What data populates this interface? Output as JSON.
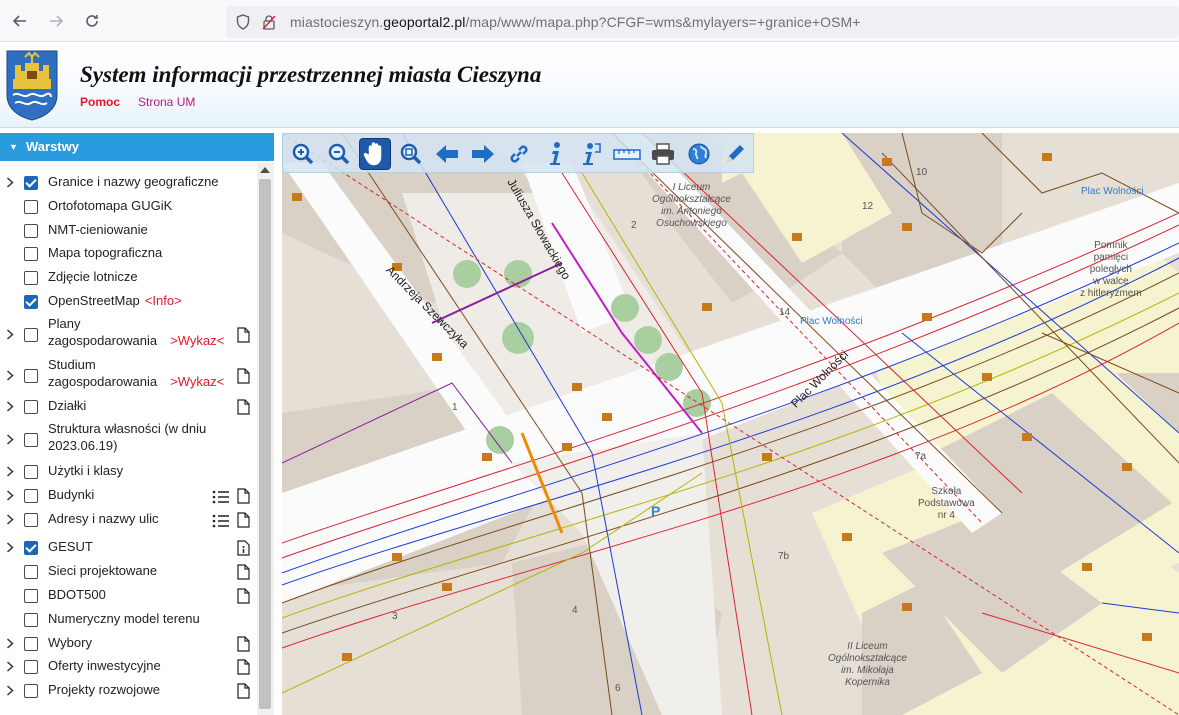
{
  "browser": {
    "url_prefix": "miastocieszyn.",
    "url_domain": "geoportal2.pl",
    "url_path": "/map/www/mapa.php?CFGF=wms&mylayers=+granice+OSM+"
  },
  "header": {
    "title": "System informacji przestrzennej miasta Cieszyna",
    "help_link": "Pomoc",
    "um_link": "Strona UM"
  },
  "sidebar": {
    "title": "Warstwy",
    "layers": [
      {
        "label": "Granice i nazwy geograficzne",
        "checked": true,
        "expandable": true
      },
      {
        "label": "Ortofotomapa GUGiK",
        "checked": false,
        "expandable": false
      },
      {
        "label": "NMT-cieniowanie",
        "checked": false,
        "expandable": false
      },
      {
        "label": "Mapa topograficzna",
        "checked": false,
        "expandable": false
      },
      {
        "label": "Zdjęcie lotnicze",
        "checked": false,
        "expandable": false
      },
      {
        "label": "OpenStreetMap",
        "link": "<Info>",
        "checked": true,
        "expandable": false
      },
      {
        "label_line1": "Plany",
        "label_line2": "zagospodarowania",
        "link": ">Wykaz<",
        "checked": false,
        "expandable": true,
        "doc": true
      },
      {
        "label_line1": "Studium",
        "label_line2": "zagospodarowania",
        "link": ">Wykaz<",
        "checked": false,
        "expandable": true,
        "doc": true
      },
      {
        "label": "Działki",
        "checked": false,
        "expandable": true,
        "doc": true
      },
      {
        "label_line1": "Struktura własności (w dniu",
        "label_line2": "2023.06.19)",
        "checked": false,
        "expandable": true
      },
      {
        "label": "Użytki i klasy",
        "checked": false,
        "expandable": true
      },
      {
        "label": "Budynki",
        "checked": false,
        "expandable": true,
        "doc": true,
        "list": true
      },
      {
        "label": "Adresy i nazwy ulic",
        "checked": false,
        "expandable": true,
        "doc": true,
        "list": true
      },
      {
        "label": "GESUT",
        "checked": true,
        "expandable": true,
        "info_doc": true
      },
      {
        "label": "Sieci projektowane",
        "checked": false,
        "expandable": false,
        "doc": true
      },
      {
        "label": "BDOT500",
        "checked": false,
        "expandable": false,
        "doc": true
      },
      {
        "label": "Numeryczny model terenu",
        "checked": false,
        "expandable": false
      },
      {
        "label": "Wybory",
        "checked": false,
        "expandable": true,
        "doc": true
      },
      {
        "label": "Oferty inwestycyjne",
        "checked": false,
        "expandable": true,
        "doc": true
      },
      {
        "label": "Projekty rozwojowe",
        "checked": false,
        "expandable": true,
        "doc": true
      }
    ]
  },
  "toolbar": {
    "tools": [
      "zoom-in-icon",
      "zoom-out-icon",
      "pan-hand-icon",
      "zoom-box-icon",
      "back-arrow-icon",
      "forward-arrow-icon",
      "link-icon",
      "info-icon",
      "info-query-icon",
      "measure-icon",
      "print-icon",
      "globe-icon",
      "draw-pencil-icon"
    ],
    "active_tool": "pan-hand-icon"
  },
  "map": {
    "labels": {
      "liceum1_line1": "I Liceum",
      "liceum1_line2": "Ogólnokształcące",
      "liceum1_line3": "im. Antoniego",
      "liceum1_line4": "Osuchowskiego",
      "plac_wolnosci": "Plac Wolności",
      "plac_wolnosci2": "Plac Wolności",
      "plac_wolnosci_street": "Plac Wolności",
      "pomnik_line1": "Pomnik",
      "pomnik_line2": "pamięci",
      "pomnik_line3": "poległych",
      "pomnik_line4": "w walce",
      "pomnik_line5": "z hitleryzmem",
      "street_slowackiego": "Juliusza Słowackiego",
      "street_szewczyka": "Andrzeja Szewczyka",
      "szkola_line1": "Szkoła",
      "szkola_line2": "Podstawowa",
      "szkola_line3": "nr 4",
      "liceum2_line1": "II Liceum",
      "liceum2_line2": "Ogólnokształcące",
      "liceum2_line3": "im. Mikołaja",
      "liceum2_line4": "Kopernika",
      "num_10": "10",
      "num_12": "12",
      "num_2": "2",
      "num_14": "14",
      "num_1": "1",
      "num_7a": "7a",
      "num_7b": "7b",
      "num_4": "4",
      "num_3": "3",
      "num_6": "6",
      "parking": "P"
    }
  }
}
